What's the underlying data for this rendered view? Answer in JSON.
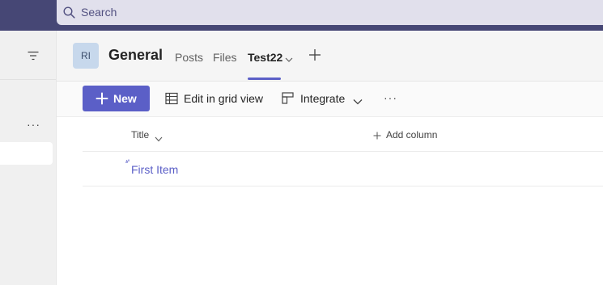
{
  "search": {
    "placeholder": "Search"
  },
  "header": {
    "avatar_initials": "RI",
    "channel_name": "General",
    "tabs": [
      {
        "label": "Posts",
        "active": false
      },
      {
        "label": "Files",
        "active": false
      },
      {
        "label": "Test22",
        "active": true
      }
    ]
  },
  "toolbar": {
    "new_label": "New",
    "edit_grid_label": "Edit in grid view",
    "integrate_label": "Integrate",
    "more_label": "···"
  },
  "left_pane": {
    "more_label": "···"
  },
  "list": {
    "columns": [
      {
        "label": "Title"
      }
    ],
    "add_column_label": "Add column",
    "rows": [
      {
        "title": "First Item"
      }
    ]
  },
  "colors": {
    "accent": "#5b5fc7",
    "topbar": "#464775",
    "search_bg": "#e1e0ec",
    "avatar_bg": "#c7d8ec"
  },
  "icons": [
    "search-icon",
    "filter-icon",
    "chevron-down-icon",
    "add-tab-icon",
    "plus-icon",
    "grid-icon",
    "integrate-icon",
    "loading-icon"
  ]
}
